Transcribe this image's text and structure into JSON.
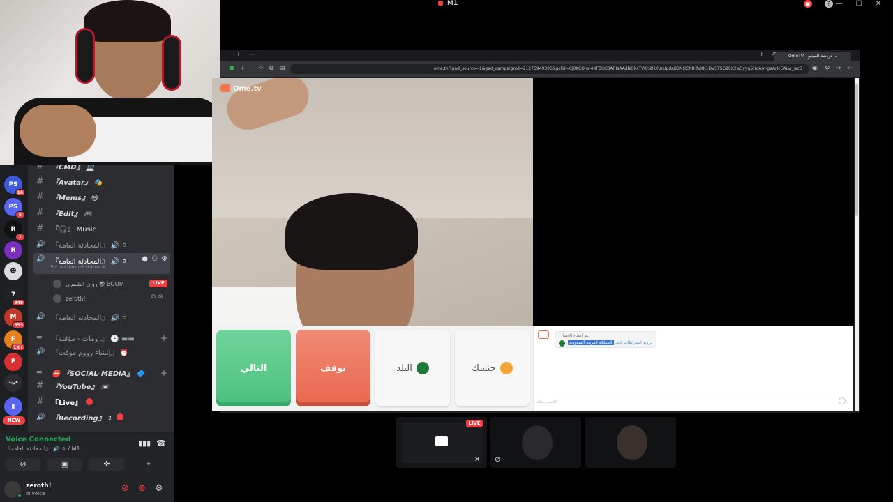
{
  "window": {
    "title": "M1",
    "controls": [
      "—",
      "☐",
      "✕"
    ]
  },
  "servers": [
    {
      "label": "PS",
      "color": "#3b5bdb",
      "badge": "16"
    },
    {
      "label": "PS",
      "color": "#5865f2",
      "badge": "5"
    },
    {
      "label": "R",
      "color": "#111111",
      "badge": "1"
    },
    {
      "label": "R",
      "color": "#7b2fbe",
      "badge": ""
    },
    {
      "label": "☻",
      "color": "#dddddd",
      "badge": ""
    },
    {
      "label": "7",
      "color": "#222222",
      "badge": "348"
    },
    {
      "label": "M",
      "color": "#c0392b",
      "badge": "553"
    },
    {
      "label": "F",
      "color": "#e67e22",
      "badge": "1K+"
    },
    {
      "label": "F",
      "color": "#d63031",
      "badge": ""
    },
    {
      "label": "قرية",
      "color": "#2b2d31",
      "badge": ""
    },
    {
      "label": "▮",
      "color": "#5865f2",
      "badge": ""
    }
  ],
  "new_tag": "NEW",
  "channels": [
    {
      "icon": "#",
      "name": "『CMD』 💻",
      "bold": true
    },
    {
      "icon": "#",
      "name": "『Avatar』 🎭",
      "bold": true
    },
    {
      "icon": "#",
      "name": "『Mems』 😄",
      "bold": true
    },
    {
      "icon": "#",
      "name": "『Edit』 🎮",
      "bold": true
    },
    {
      "icon": "#",
      "name": "『🎧』 Music",
      "bold": false
    },
    {
      "icon": "🔊",
      "name": "『المحادثة العامة』 🔊 ⚪",
      "bold": false
    }
  ],
  "active_channel": {
    "name": "『المحادثة العامة』 🔊 ⚪",
    "status": "Set a channel status ✏"
  },
  "voice_users": [
    {
      "name": "روان الشمري 😎 BOOM",
      "live": "LIVE"
    },
    {
      "name": "zeroth!",
      "live": ""
    }
  ],
  "channels_after": [
    {
      "icon": "🔊",
      "name": "『المحادثة العامة』 🔊 ⚪"
    },
    {
      "icon": "▬",
      "name": "『رومات - مؤقتة』 🕒 ▬▬"
    },
    {
      "icon": "🔊",
      "name": "『إنشاء رووم مؤقت』 ⏰"
    },
    {
      "icon": "▬",
      "name": "⛔ 『SOCIAL-MEDIA』 🔷"
    },
    {
      "icon": "#",
      "name": "『YouTube』 📼"
    },
    {
      "icon": "#",
      "name": "『Live』"
    },
    {
      "icon": "🔊",
      "name": "『Recording』 1"
    }
  ],
  "voice_panel": {
    "status": "Voice Connected",
    "channel": "『المحادثة العامة』 🔊 ⚪ / M1"
  },
  "user_panel": {
    "name": "zeroth!",
    "status": "In voice"
  },
  "browser": {
    "tab_title": "OmeTV - دردشة الفيديو ...",
    "url": "ome.tv/?gad_source=1&gad_campaignid=21275949306&gclid=Cj0KCQjw-4XFBhCBARIsAAdNOksTVKh2HXUrUpdaBBNHCNIHfxXK1DV5TSG19X2w5yyq5HoAm-gaArIcEALw_wcB"
  },
  "ometv": {
    "logo": "Ome.tv",
    "next": "التالي",
    "stop": "توقف",
    "country": "البلد",
    "gender": "جنسك",
    "chat_line1": "تم إنشاء الاتصال.",
    "chat_country": "المملكة العربية السعودية",
    "chat_agreement": "تزويد اشتراطات كلمـ",
    "chat_placeholder": "اكتب رسالة"
  },
  "streams": [
    {
      "live": "LIVE"
    },
    {
      "live": ""
    },
    {
      "live": ""
    }
  ]
}
